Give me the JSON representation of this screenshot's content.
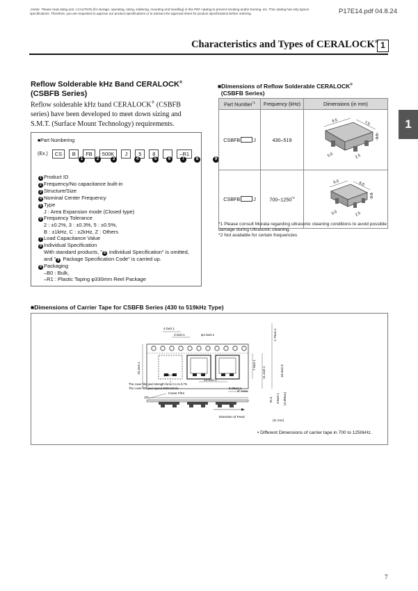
{
  "header": {
    "note_label": "⚠Note",
    "note_text": "Please read rating and ⚠CAUTION (for storage, operating, rating, soldering, mounting and handling) in this PDF catalog to prevent smoking and/or burning, etc. This catalog has only typical specifications. Therefore, you are requested to approve our product specifications or to transact the approval sheet for product specifications before ordering.",
    "doc_ref": "P17E14.pdf 04.8.24"
  },
  "section": {
    "title": "Characteristics and Types of CERALOCK",
    "reg": "®",
    "number": "1",
    "tab": "1"
  },
  "product": {
    "title_line1": "Reflow Solderable kHz Band CERALOCK",
    "reg": "®",
    "title_line2": "(CSBFB Series)",
    "desc_part1": "Reflow solderable kHz band CERALOCK",
    "desc_reg": "®",
    "desc_part2": " (CSBFB series) have been developed to meet down sizing and S.M.T. (Surface Mount Technology) requirements."
  },
  "part_numbering": {
    "heading": "■Part Numbering",
    "example_label": "(Ex.)",
    "cells": [
      "CS",
      "B",
      "FB",
      "500K",
      "J",
      "5",
      "8",
      "",
      "–R1"
    ],
    "circle_numbers": [
      "1",
      "2",
      "3",
      "4",
      "5",
      "6",
      "7",
      "8",
      "9"
    ],
    "items": [
      {
        "num": "1",
        "text": "Product ID"
      },
      {
        "num": "2",
        "text": "Frequency/No capacitance built-in"
      },
      {
        "num": "3",
        "text": "Structure/Size"
      },
      {
        "num": "4",
        "text": "Nominal Center Frequency"
      },
      {
        "num": "5",
        "text": "Type"
      }
    ],
    "type_detail": "J : Area Expansion mode (Closed type)",
    "tol_label": "Frequency Tolerance",
    "tol_line1": "2 : ±0.2%, 3 : ±0.3%, 5 : ±0.5%,",
    "tol_line2": "B : ±1kHz, C : ±2kHz, Z : Others",
    "load_label": "Load Capacitance Value",
    "indiv_label": "Individual Specification",
    "indiv_text1": "With standard products, \"",
    "indiv_text2": " individual Specification\" is omitted, and \"",
    "indiv_text3": " Package Specification Code\" is carried up.",
    "pkg_label": "Packaging",
    "pkg_line1": "–B0 : Bulk,",
    "pkg_line2": "–R1 : Plastic Taping φ330mm Reel Package"
  },
  "dimensions": {
    "title_line1": "■Dimensions of Reflow Solderable CERALOCK",
    "reg": "®",
    "title_line2": "(CSBFB Series)",
    "headers": {
      "part": "Part Number",
      "part_sup": "*1",
      "freq": "Frequency (kHz)",
      "dims": "Dimensions (in mm)"
    },
    "rows": [
      {
        "part_prefix": "CSBFB",
        "part_suffix": "J",
        "freq": "430–519",
        "freq_sup": "",
        "dims_labels": [
          "8.5",
          "7.5",
          "3.5",
          "5.0",
          "2.5"
        ]
      },
      {
        "part_prefix": "CSBFB",
        "part_suffix": "J",
        "freq": "700–1250",
        "freq_sup": "*2",
        "dims_labels": [
          "6.0",
          "6.0",
          "2.5",
          "5.0",
          "2.5"
        ]
      }
    ],
    "notes": [
      "*1 Please consult Murata regarding ultrasonic cleaning conditions to avoid possible damage during Ultrasonic cleaning.",
      "*2 Not available for certain frequencies"
    ]
  },
  "carrier_tape": {
    "title": "■Dimensions of Carrier Tape for CSBFB Series (430 to 519kHz Type)",
    "labels": {
      "pitch_hole": "4.0±0.1",
      "hole_offset": "2.0±0.1",
      "hole_dia": "φ1.5±0.1",
      "edge": "1.75±0.1",
      "pocket_w": "11.4±0.1",
      "pocket_sub": "7.5±0.1",
      "tape_w": "16.0±0.3",
      "left_dim": "15.3±0.1",
      "inner": "φ1.5 min",
      "pocket_pitch": "12.0±0.1",
      "peel1": "The cover film peel strength force 0.1 to 0.7N",
      "peel2": "The cover film peel speed 300mm/min.",
      "depth": "6.05±0.1",
      "angle": "3° max.",
      "cover": "Cover Film",
      "angle2": "10°",
      "t1": "t0.3",
      "t2": "3.9±0.1",
      "t3": "(4.0Max)",
      "feed": "Direction of Feed"
    },
    "unit_note": "(in mm)",
    "note": "• Different Dimensions of carrier tape in 700 to 1250kHz."
  },
  "page_number": "7"
}
